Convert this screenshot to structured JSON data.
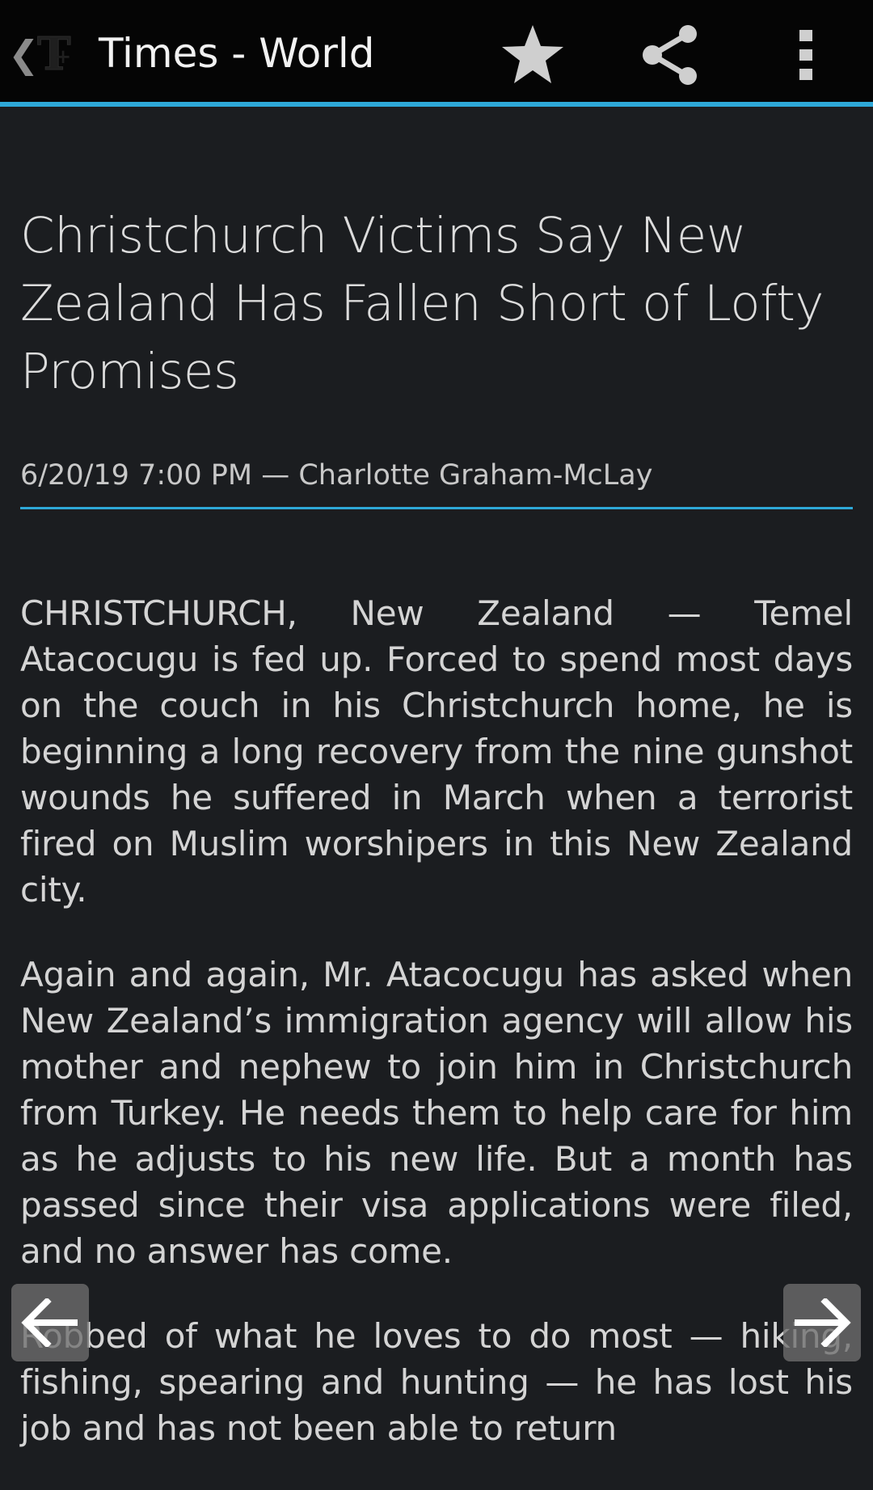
{
  "action_bar": {
    "title": "Times - World",
    "back_glyph": "❮",
    "logo_icon": "times-t-logo-icon",
    "actions": [
      {
        "name": "star",
        "icon": "star-icon"
      },
      {
        "name": "share",
        "icon": "share-icon"
      },
      {
        "name": "overflow",
        "icon": "overflow-menu-icon"
      }
    ]
  },
  "article": {
    "headline": "Christchurch Victims Say New Zealand Has Fallen Short of Lofty Promises",
    "byline": "6/20/19 7:00 PM — Charlotte Graham-McLay",
    "paragraphs": [
      "CHRISTCHURCH, New Zealand — Temel Atacocugu is fed up. Forced to spend most days on the couch in his Christchurch home, he is beginning a long recovery from the nine gunshot wounds he suffered in March when a terrorist fired on Muslim worshipers in this New Zealand city.",
      "Again and again, Mr. Atacocugu has asked when New Zealand’s immigration agency will allow his mother and nephew to join him in Christchurch from Turkey. He needs them to help care for him as he adjusts to his new life. But a month has passed since their visa applications were filed, and no answer has come.",
      "Robbed of what he loves to do most — hiking, fishing, spearing and hunting — he has lost his job and has not been able to return"
    ]
  },
  "navigation": {
    "prev_icon": "arrow-left-icon",
    "next_icon": "arrow-right-icon"
  },
  "colors": {
    "accent": "#2ea8d8",
    "background": "#1b1d20",
    "action_bar": "#050505"
  }
}
